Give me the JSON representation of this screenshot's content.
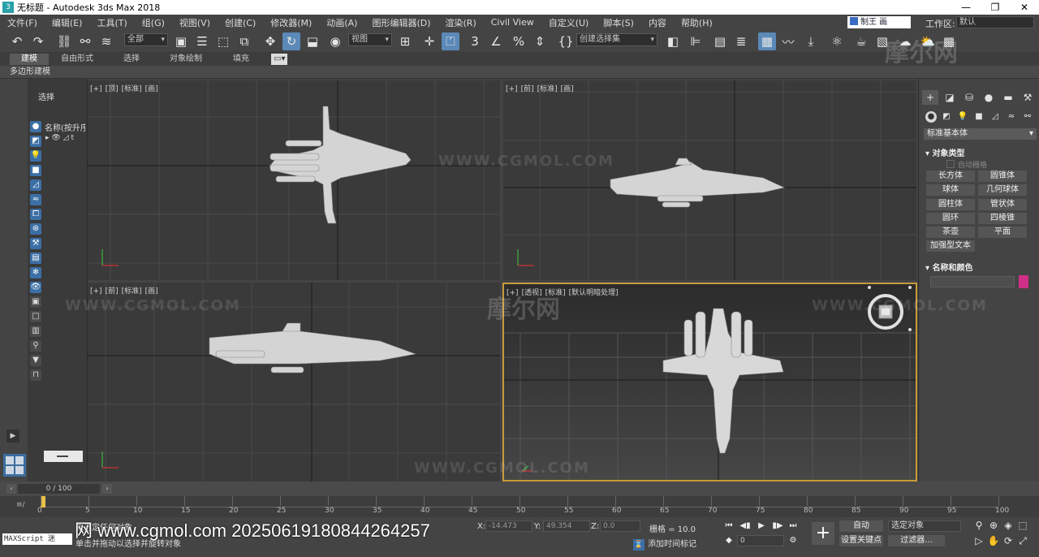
{
  "window": {
    "title": "无标题 - Autodesk 3ds Max 2018",
    "controls": [
      "—",
      "❐",
      "✕"
    ]
  },
  "menu": {
    "items": [
      "文件(F)",
      "编辑(E)",
      "工具(T)",
      "组(G)",
      "视图(V)",
      "创建(C)",
      "修改器(M)",
      "动画(A)",
      "图形编辑器(D)",
      "渲染(R)",
      "Civil View",
      "自定义(U)",
      "脚本(S)",
      "内容",
      "帮助(H)"
    ],
    "user": "制王 画",
    "workspace_label": "工作区:",
    "workspace_value": "默认"
  },
  "toolbar": {
    "filter_select": "全部",
    "view_select": "视图",
    "named_selection": "创建选择集"
  },
  "ribbon": {
    "tabs": [
      "建模",
      "自由形式",
      "选择",
      "对象绘制",
      "填充"
    ],
    "subtab": "多边形建模"
  },
  "explorer": {
    "title": "选择",
    "column": "名称(按升序)",
    "row": "t"
  },
  "viewports": {
    "top": [
      "[+]",
      "[顶]",
      "[标准]",
      "[画]"
    ],
    "front": [
      "[+]",
      "[前]",
      "[标准]",
      "[画]"
    ],
    "left": [
      "[+]",
      "[前]",
      "[标准]",
      "[画]"
    ],
    "persp": [
      "[+]",
      "[透视]",
      "[标准]",
      "[默认明暗处理]"
    ]
  },
  "command_panel": {
    "category": "标准基本体",
    "rollout_object_type": "对象类型",
    "auto_grid": "自动栅格",
    "object_buttons": [
      "长方体",
      "圆锥体",
      "球体",
      "几何球体",
      "圆柱体",
      "管状体",
      "圆环",
      "四棱锥",
      "茶壶",
      "平面",
      "加强型文本"
    ],
    "rollout_name_color": "名称和颜色",
    "color": "#cf2f86"
  },
  "timeline": {
    "slider": "0 / 100",
    "ticks": [
      "0",
      "5",
      "10",
      "15",
      "20",
      "25",
      "30",
      "35",
      "40",
      "45",
      "50",
      "55",
      "60",
      "65",
      "70",
      "75",
      "80",
      "85",
      "90",
      "95",
      "100"
    ]
  },
  "status": {
    "maxscript": "MAXScript 迷",
    "selection": "未选定任何对象",
    "hint": "单击并拖动以选择并旋转对象",
    "x_label": "X:",
    "x_value": "-14.473",
    "y_label": "Y:",
    "y_value": "49.354",
    "z_label": "Z:",
    "z_value": "0.0",
    "grid": "栅格 = 10.0",
    "add_time_tag": "添加时间标记",
    "frame": "0",
    "auto_key": "自动",
    "set_key": "设置关键点",
    "selected_object": "选定对象",
    "filters": "过滤器..."
  },
  "watermark": {
    "text": "网 www.cgmol.com 20250619180844264257",
    "faint": "WWW.CGMOL.COM",
    "brand": "摩尔网"
  }
}
